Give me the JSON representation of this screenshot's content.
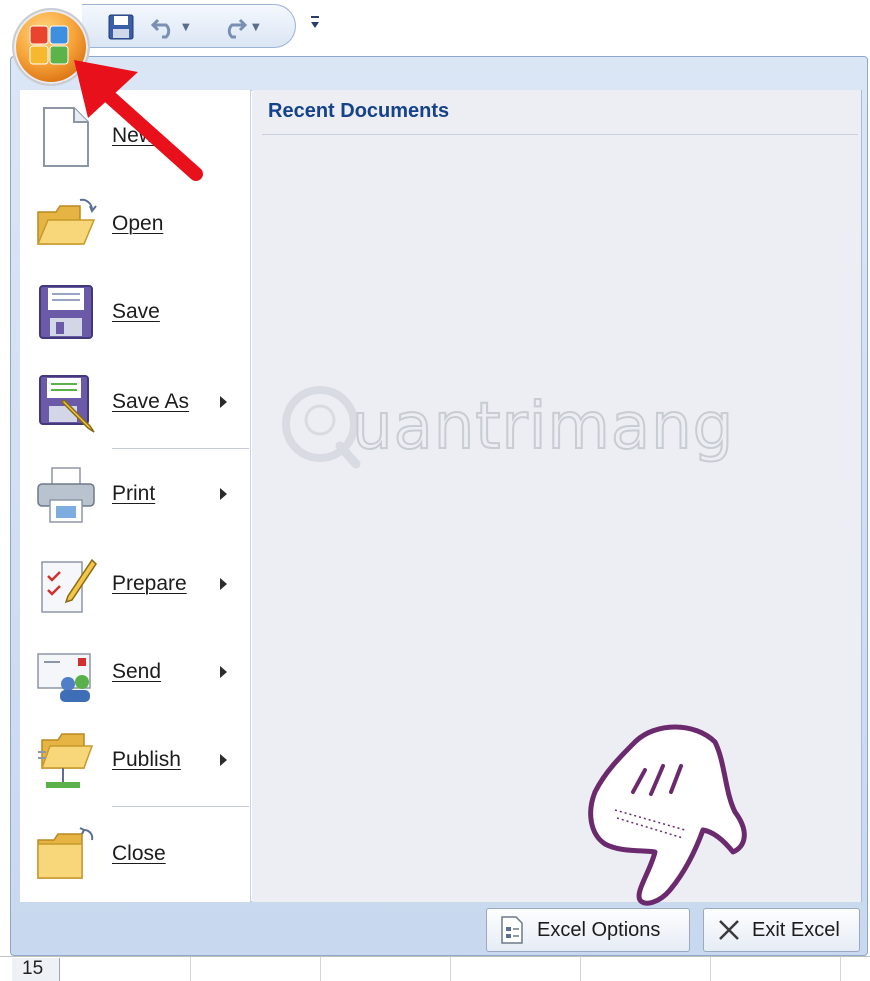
{
  "quick_access": {
    "items": [
      {
        "name": "save-icon"
      },
      {
        "name": "undo-icon"
      },
      {
        "name": "redo-icon"
      }
    ],
    "customize_icon": "qat-customize-icon"
  },
  "office_button": {
    "icon": "office-logo-icon"
  },
  "menu": {
    "items": [
      {
        "label": "New",
        "icon": "new-document-icon",
        "has_submenu": false
      },
      {
        "label": "Open",
        "icon": "open-folder-icon",
        "has_submenu": false
      },
      {
        "label": "Save",
        "icon": "save-disk-icon",
        "has_submenu": false
      },
      {
        "label": "Save As",
        "icon": "save-as-icon",
        "has_submenu": true
      },
      {
        "label": "Print",
        "icon": "printer-icon",
        "has_submenu": true
      },
      {
        "label": "Prepare",
        "icon": "prepare-icon",
        "has_submenu": true
      },
      {
        "label": "Send",
        "icon": "send-icon",
        "has_submenu": true
      },
      {
        "label": "Publish",
        "icon": "publish-icon",
        "has_submenu": true
      },
      {
        "label": "Close",
        "icon": "close-folder-icon",
        "has_submenu": false
      }
    ]
  },
  "recent": {
    "title": "Recent Documents"
  },
  "footer": {
    "options_label": "Excel Options",
    "exit_label": "Exit Excel"
  },
  "sheet": {
    "row_number": "15"
  },
  "watermark": {
    "text": "uantrimang"
  },
  "colors": {
    "accent": "#15428b",
    "office_orange": "#f7a43a",
    "arrow_red": "#e8101a",
    "hand_purple": "#6b2a6e"
  }
}
